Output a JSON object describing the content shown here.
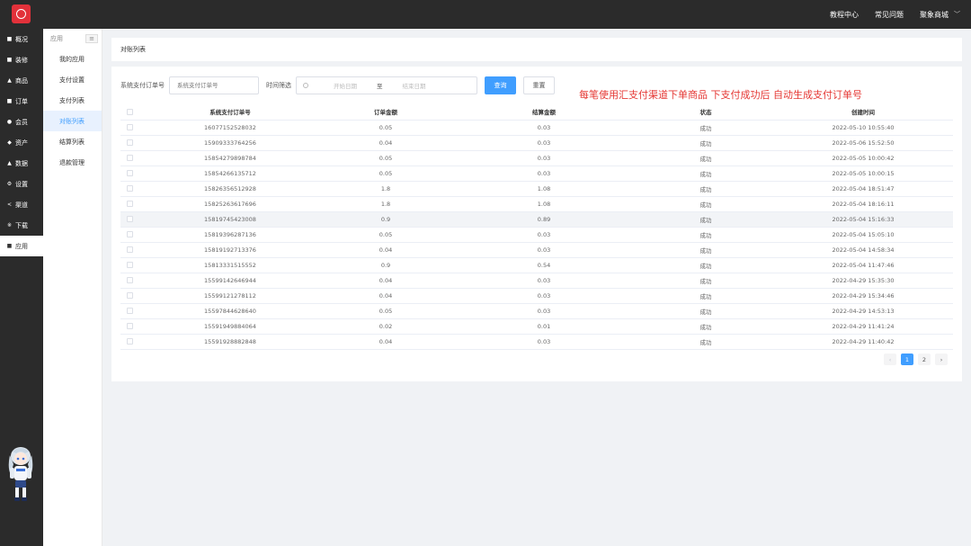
{
  "topbar": {
    "links": [
      "教程中心",
      "常见问题",
      "聚象商城"
    ],
    "chevron": "﹀"
  },
  "sidebar": {
    "items": [
      {
        "icon": "■",
        "label": "概况"
      },
      {
        "icon": "■",
        "label": "装修"
      },
      {
        "icon": "▲",
        "label": "商品"
      },
      {
        "icon": "■",
        "label": "订单"
      },
      {
        "icon": "●",
        "label": "会员"
      },
      {
        "icon": "◆",
        "label": "资产"
      },
      {
        "icon": "▲",
        "label": "数据"
      },
      {
        "icon": "⚙",
        "label": "设置"
      },
      {
        "icon": "<",
        "label": "渠道"
      },
      {
        "icon": "※",
        "label": "下载"
      },
      {
        "icon": "■",
        "label": "应用"
      }
    ]
  },
  "subnav": {
    "header": "应用",
    "menu_icon": "≡",
    "items": [
      "我的应用",
      "支付设置",
      "支付列表",
      "对账列表",
      "结算列表",
      "退款管理"
    ]
  },
  "breadcrumb": "对账列表",
  "filters": {
    "order_label": "系统支付订单号",
    "order_placeholder": "系统支付订单号",
    "time_label": "时间筛选",
    "start_placeholder": "开始日期",
    "range_sep": "至",
    "end_placeholder": "结束日期",
    "search_label": "查询",
    "reset_label": "重置"
  },
  "notice": "每笔使用汇支付渠道下单商品 下支付成功后 自动生成支付订单号",
  "table": {
    "headers": [
      "系统支付订单号",
      "订单金额",
      "结算金额",
      "状态",
      "创建时间"
    ],
    "rows": [
      [
        "16077152528032",
        "0.05",
        "0.03",
        "成功",
        "2022-05-10 10:55:40"
      ],
      [
        "15909333764256",
        "0.04",
        "0.03",
        "成功",
        "2022-05-06 15:52:50"
      ],
      [
        "15854279898784",
        "0.05",
        "0.03",
        "成功",
        "2022-05-05 10:00:42"
      ],
      [
        "15854266135712",
        "0.05",
        "0.03",
        "成功",
        "2022-05-05 10:00:15"
      ],
      [
        "15826356512928",
        "1.8",
        "1.08",
        "成功",
        "2022-05-04 18:51:47"
      ],
      [
        "15825263617696",
        "1.8",
        "1.08",
        "成功",
        "2022-05-04 18:16:11"
      ],
      [
        "15819745423008",
        "0.9",
        "0.89",
        "成功",
        "2022-05-04 15:16:33"
      ],
      [
        "15819396287136",
        "0.05",
        "0.03",
        "成功",
        "2022-05-04 15:05:10"
      ],
      [
        "15819192713376",
        "0.04",
        "0.03",
        "成功",
        "2022-05-04 14:58:34"
      ],
      [
        "15813331515552",
        "0.9",
        "0.54",
        "成功",
        "2022-05-04 11:47:46"
      ],
      [
        "15599142646944",
        "0.04",
        "0.03",
        "成功",
        "2022-04-29 15:35:30"
      ],
      [
        "15599121278112",
        "0.04",
        "0.03",
        "成功",
        "2022-04-29 15:34:46"
      ],
      [
        "15597844628640",
        "0.05",
        "0.03",
        "成功",
        "2022-04-29 14:53:13"
      ],
      [
        "15591949884064",
        "0.02",
        "0.01",
        "成功",
        "2022-04-29 11:41:24"
      ],
      [
        "15591928882848",
        "0.04",
        "0.03",
        "成功",
        "2022-04-29 11:40:42"
      ]
    ]
  },
  "pagination": {
    "prev": "‹",
    "pages": [
      "1",
      "2"
    ],
    "next": "›"
  },
  "colors": {
    "accent": "#409eff",
    "notice": "#e53935",
    "dark": "#2b2b2b",
    "logo": "#e2313a"
  }
}
